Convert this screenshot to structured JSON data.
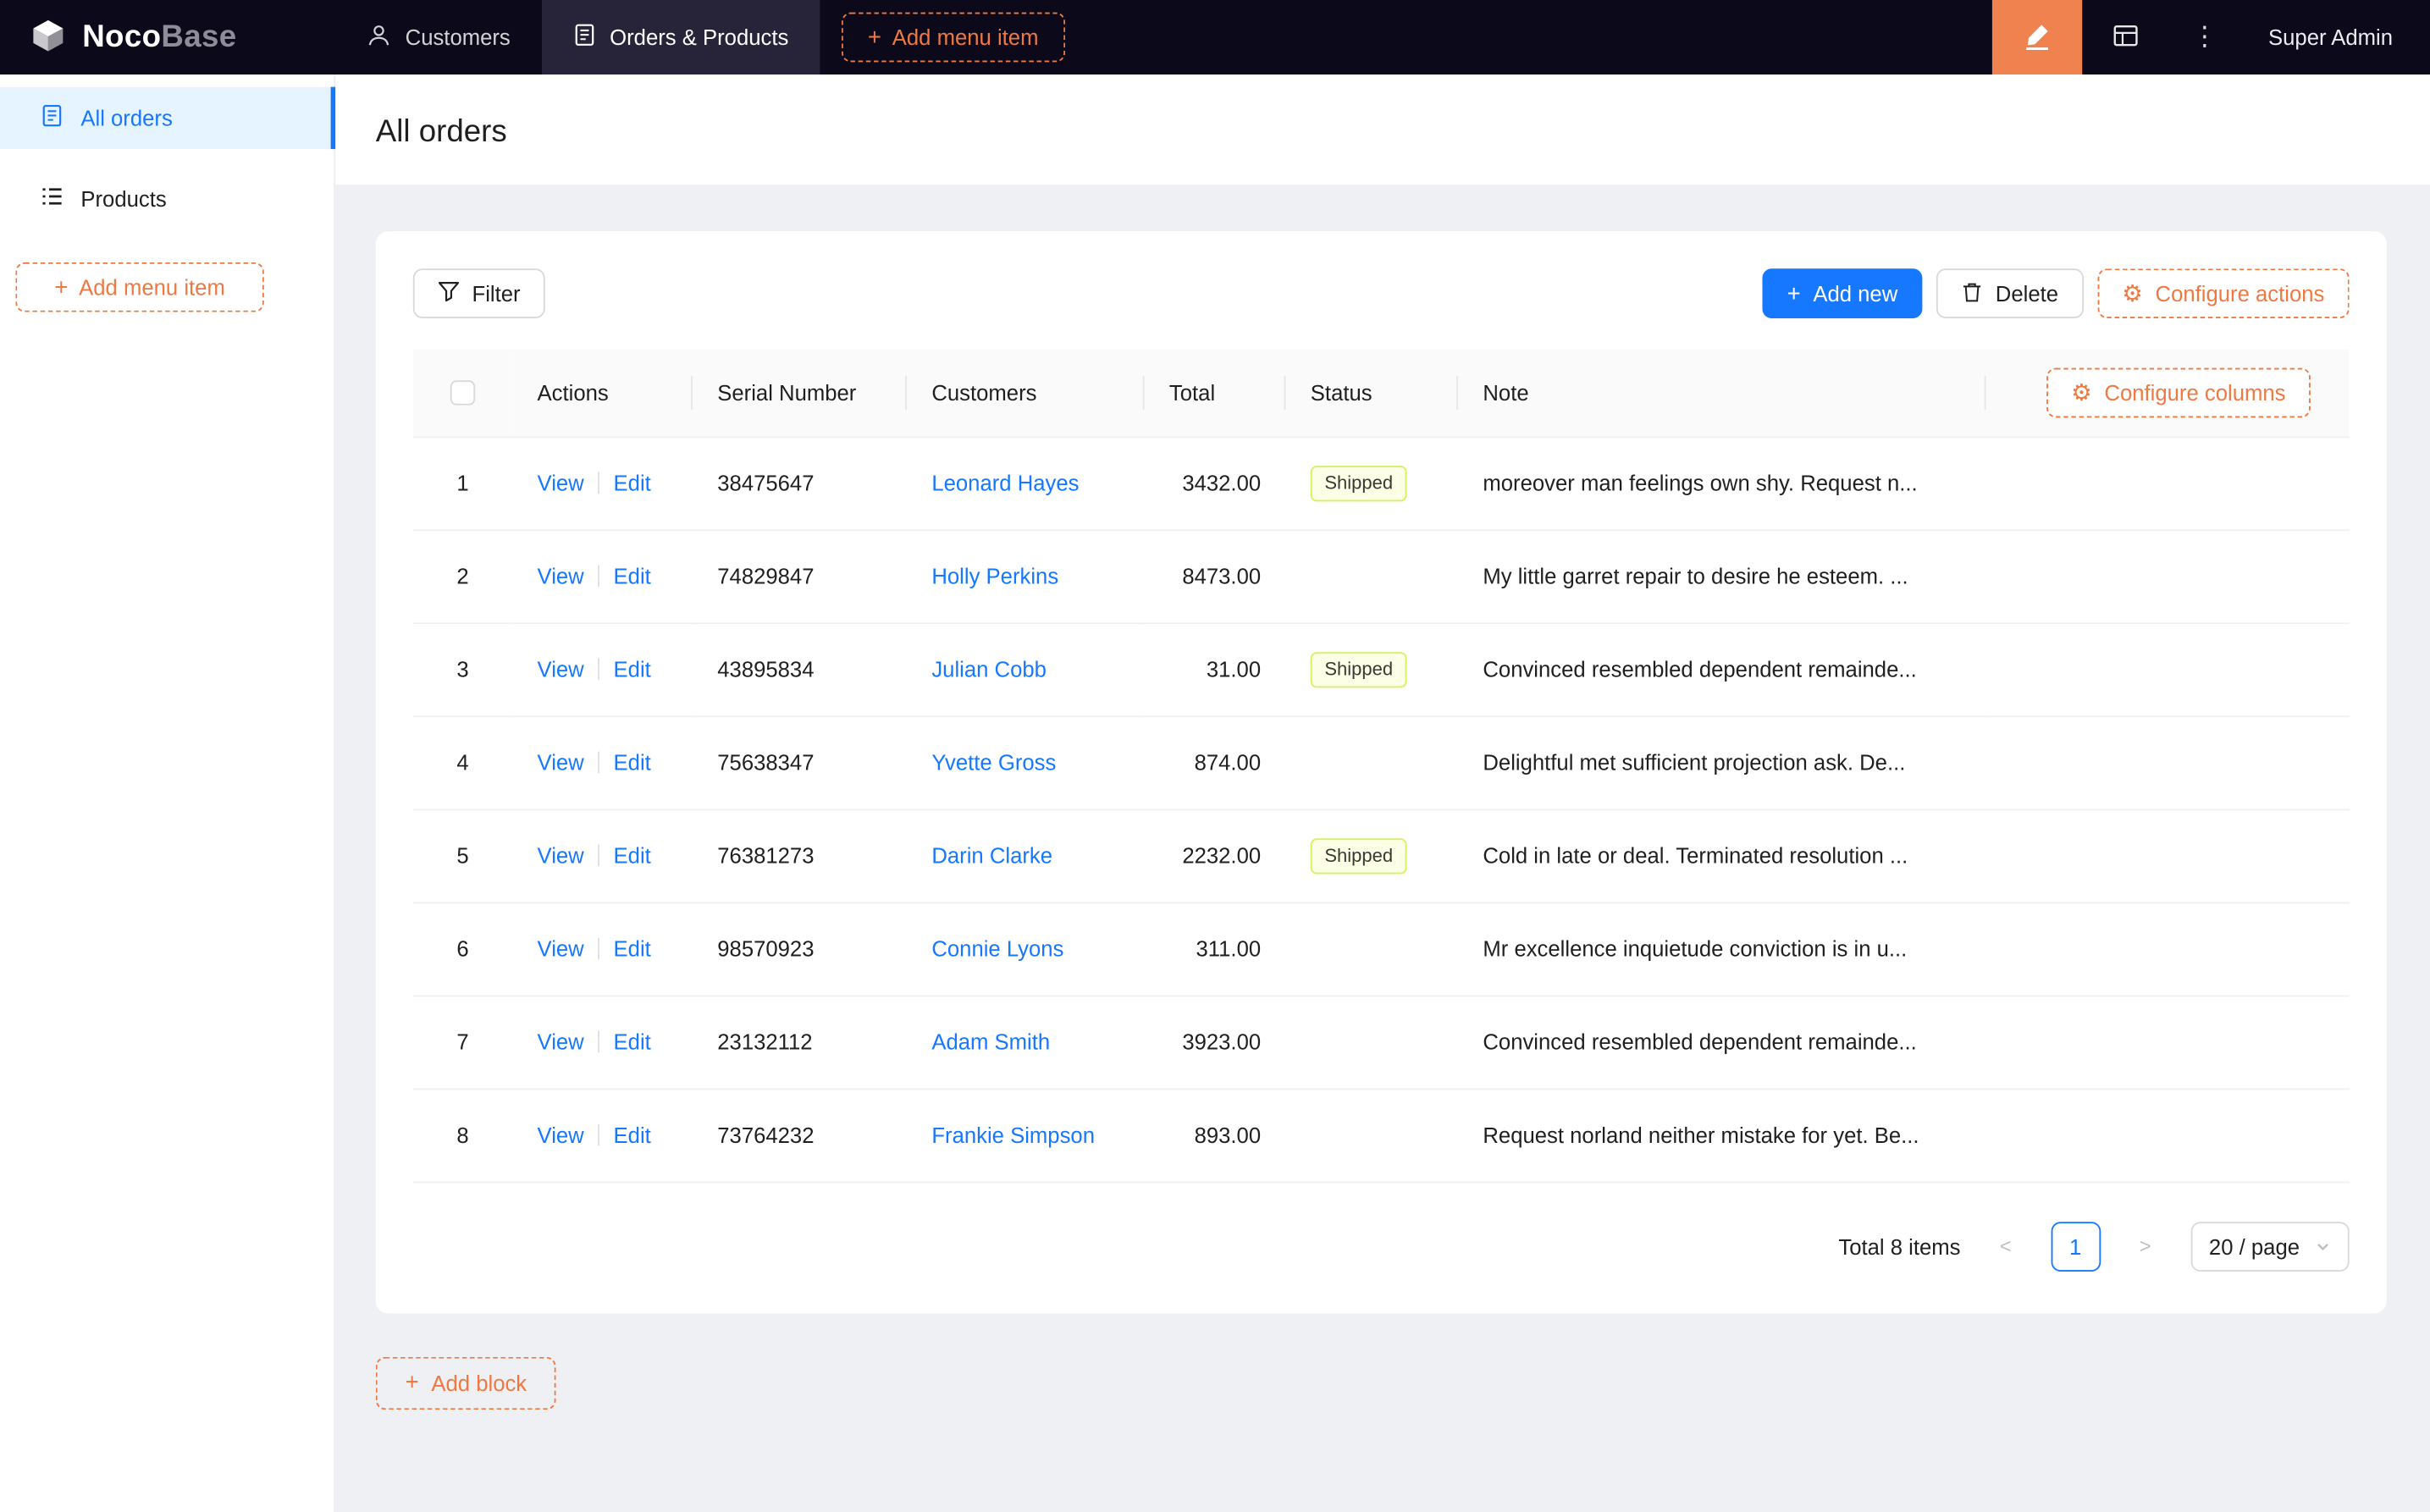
{
  "icons": {
    "plus": "+",
    "gear": "⚙",
    "more": "⋮",
    "prev": "<",
    "next": ">"
  },
  "navbar": {
    "logo_noco": "Noco",
    "logo_base": "Base",
    "menu": [
      {
        "label": "Customers"
      },
      {
        "label": "Orders & Products"
      }
    ],
    "add_menu_item": "Add menu item",
    "user": "Super Admin"
  },
  "sidebar": {
    "items": [
      {
        "label": "All orders"
      },
      {
        "label": "Products"
      }
    ],
    "add_menu_item": "Add menu item"
  },
  "page": {
    "title": "All orders"
  },
  "toolbar": {
    "filter": "Filter",
    "add_new": "Add new",
    "delete": "Delete",
    "configure_actions": "Configure actions",
    "configure_columns": "Configure columns"
  },
  "table": {
    "headers": {
      "actions": "Actions",
      "serial": "Serial Number",
      "customers": "Customers",
      "total": "Total",
      "status": "Status",
      "note": "Note"
    },
    "actions": {
      "view": "View",
      "edit": "Edit"
    },
    "rows": [
      {
        "index": "1",
        "serial": "38475647",
        "customer": "Leonard Hayes",
        "total": "3432.00",
        "status": "Shipped",
        "note": "moreover man feelings own shy. Request n..."
      },
      {
        "index": "2",
        "serial": "74829847",
        "customer": "Holly Perkins",
        "total": "8473.00",
        "status": "",
        "note": "My little garret repair to desire he esteem. ..."
      },
      {
        "index": "3",
        "serial": "43895834",
        "customer": "Julian Cobb",
        "total": "31.00",
        "status": "Shipped",
        "note": "Convinced resembled dependent remainde..."
      },
      {
        "index": "4",
        "serial": "75638347",
        "customer": "Yvette Gross",
        "total": "874.00",
        "status": "",
        "note": "Delightful met sufficient projection ask. De..."
      },
      {
        "index": "5",
        "serial": "76381273",
        "customer": "Darin Clarke",
        "total": "2232.00",
        "status": "Shipped",
        "note": "Cold in late or deal. Terminated resolution ..."
      },
      {
        "index": "6",
        "serial": "98570923",
        "customer": "Connie Lyons",
        "total": "311.00",
        "status": "",
        "note": "Mr excellence inquietude conviction is in u..."
      },
      {
        "index": "7",
        "serial": "23132112",
        "customer": "Adam Smith",
        "total": "3923.00",
        "status": "",
        "note": "Convinced resembled dependent remainde..."
      },
      {
        "index": "8",
        "serial": "73764232",
        "customer": "Frankie Simpson",
        "total": "893.00",
        "status": "",
        "note": "Request norland neither mistake for yet. Be..."
      }
    ]
  },
  "pagination": {
    "total": "Total 8 items",
    "current_page": "1",
    "page_size": "20 / page"
  },
  "add_block": "Add block",
  "colors": {
    "navbar_bg": "#0c0a1a",
    "accent_orange": "#EE7942",
    "editor_button_bg": "#F0824F",
    "primary_blue": "#1677ff",
    "sidebar_active_bg": "#e6f4ff",
    "tag_bg": "#fcffe6",
    "tag_border": "#d3f261",
    "content_bg": "#eef0f3"
  }
}
